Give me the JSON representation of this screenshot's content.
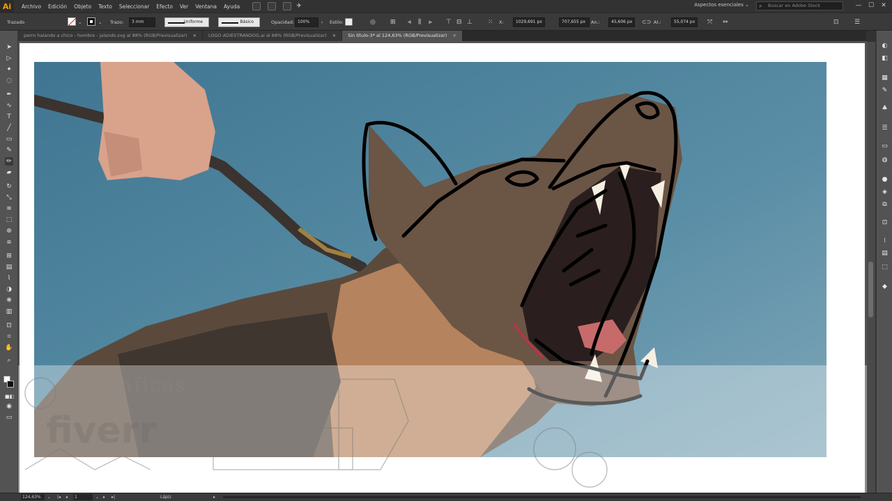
{
  "app": {
    "logo": "Ai"
  },
  "menu": {
    "items": [
      "Archivo",
      "Edición",
      "Objeto",
      "Texto",
      "Seleccionar",
      "Efecto",
      "Ver",
      "Ventana",
      "Ayuda"
    ]
  },
  "workspace": {
    "label": "Aspectos esenciales"
  },
  "stock_search": {
    "placeholder": "Buscar en Adobe Stock"
  },
  "control": {
    "selection_label": "Trazado",
    "stroke_label": "Trazo:",
    "stroke_weight": "3 mm",
    "profile": "Uniforme",
    "brush": "Básico",
    "opacity_label": "Opacidad:",
    "opacity_value": "100%",
    "style_label": "Estilo:",
    "x_label": "X:",
    "x_value": "1029,691 px",
    "y_value": "707,655 px",
    "w_label": "An.:",
    "w_value": "45,606 px",
    "h_label": "Al.:",
    "h_value": "55,074 px"
  },
  "tabs": [
    {
      "label": "perro halando a chico - hombre - jalando.svg al 88% (RGB/Previsualizar)",
      "close": "×",
      "active": false
    },
    {
      "label": "LOGO ADIESTRANDOG.ai al 88% (RGB/Previsualizar)",
      "close": "×",
      "active": false
    },
    {
      "label": "Sin título-3* al 124,63% (RGB/Previsualizar)",
      "close": "×",
      "active": true
    }
  ],
  "status": {
    "zoom": "124,63%",
    "page": "1",
    "tool": "Lápiz"
  },
  "watermark": {
    "brand_top": "tusgraficas",
    "brand": "fiverr"
  },
  "colors": {
    "panel": "#535353",
    "menubar": "#323232",
    "accent": "#ff9a00",
    "backdrop": "#4b7d96"
  },
  "icons": {
    "tools": [
      "selection-icon",
      "direct-selection-icon",
      "magic-wand-icon",
      "lasso-icon",
      "pen-icon",
      "curvature-icon",
      "type-icon",
      "line-icon",
      "rectangle-icon",
      "paintbrush-icon",
      "pencil-icon",
      "eraser-icon",
      "rotate-icon",
      "scale-icon",
      "warp-icon",
      "free-transform-icon",
      "shape-builder-icon",
      "perspective-icon",
      "mesh-icon",
      "gradient-icon",
      "eyedropper-icon",
      "blend-icon",
      "symbol-sprayer-icon",
      "graph-icon",
      "artboard-icon",
      "slice-icon",
      "hand-icon",
      "zoom-icon"
    ],
    "panels": [
      "color-icon",
      "color-guide-icon",
      "swatches-icon",
      "brushes-icon",
      "symbols-icon",
      "stroke-icon",
      "gradient-panel-icon",
      "transparency-icon",
      "appearance-icon",
      "graphic-styles-icon",
      "layers-icon",
      "artboards-icon",
      "align-icon",
      "pathfinder-icon",
      "transform-icon",
      "libraries-icon"
    ]
  }
}
